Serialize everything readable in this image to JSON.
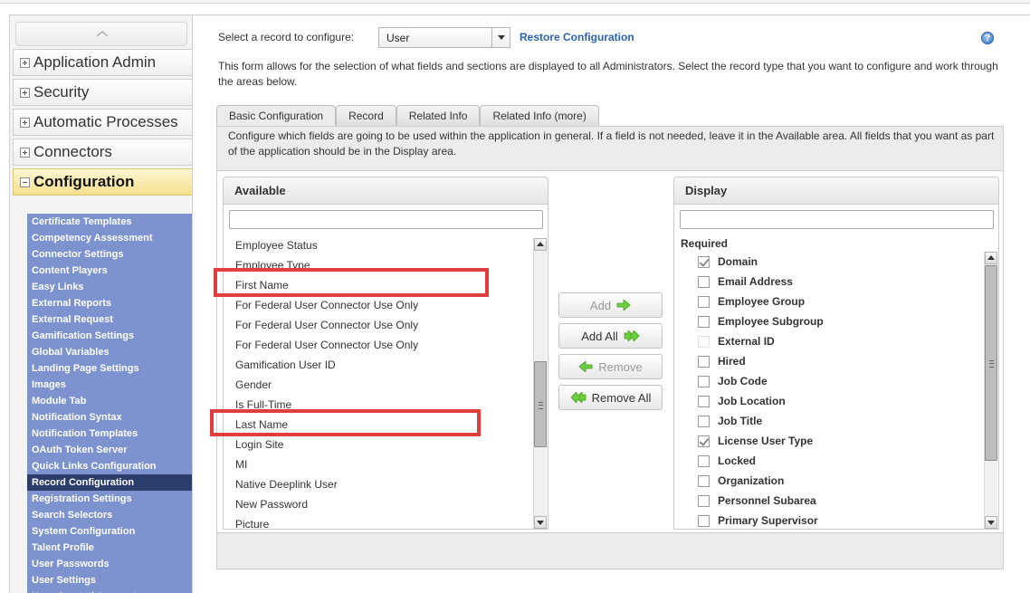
{
  "sidebar": {
    "categories": [
      {
        "label": "Application Admin"
      },
      {
        "label": "Security"
      },
      {
        "label": "Automatic Processes"
      },
      {
        "label": "Connectors"
      },
      {
        "label": "Configuration"
      }
    ],
    "sub_items": [
      "Certificate Templates",
      "Competency Assessment",
      "Connector Settings",
      "Content Players",
      "Easy Links",
      "External Reports",
      "External Request",
      "Gamification Settings",
      "Global Variables",
      "Landing Page Settings",
      "Images",
      "Module Tab",
      "Notification Syntax",
      "Notification Templates",
      "OAuth Token Server",
      "Quick Links Configuration",
      "Record Configuration",
      "Registration Settings",
      "Search Selectors",
      "System Configuration",
      "Talent Profile",
      "User Passwords",
      "User Settings",
      "User-Created Account"
    ],
    "selected_item": "Record Configuration"
  },
  "header": {
    "select_label": "Select a record to configure:",
    "record_value": "User",
    "restore_link": "Restore Configuration",
    "help_icon_glyph": "?"
  },
  "intro": "This form allows for the selection of what fields and sections are displayed to all Administrators.  Select the record type that you want to configure and work through the areas below.",
  "tabs": [
    {
      "label": "Basic Configuration",
      "active": true
    },
    {
      "label": "Record",
      "active": false
    },
    {
      "label": "Related Info",
      "active": false
    },
    {
      "label": "Related Info (more)",
      "active": false
    }
  ],
  "panel": {
    "description": "Configure which fields are going to be used within the application in general. If a field is not needed, leave it in the Available area. All fields that you want as part of the application should be in the Display area."
  },
  "available": {
    "title": "Available",
    "filter_value": "",
    "items": [
      "Employee Status",
      "Employee Type",
      "First Name",
      "For Federal User Connector Use Only",
      "For Federal User Connector Use Only",
      "For Federal User Connector Use Only",
      "Gamification User ID",
      "Gender",
      "Is Full-Time",
      "Last Name",
      "Login Site",
      "MI",
      "Native Deeplink User",
      "New Password",
      "Picture"
    ]
  },
  "buttons": {
    "add": "Add",
    "add_all": "Add All",
    "remove": "Remove",
    "remove_all": "Remove All"
  },
  "display": {
    "title": "Display",
    "filter_value": "",
    "required_label": "Required",
    "items": [
      {
        "label": "Domain",
        "checked": true,
        "box": true
      },
      {
        "label": "Email Address",
        "checked": false,
        "box": true
      },
      {
        "label": "Employee Group",
        "checked": false,
        "box": true
      },
      {
        "label": "Employee Subgroup",
        "checked": false,
        "box": true
      },
      {
        "label": "External ID",
        "checked": false,
        "box": false
      },
      {
        "label": "Hired",
        "checked": false,
        "box": true
      },
      {
        "label": "Job Code",
        "checked": false,
        "box": true
      },
      {
        "label": "Job Location",
        "checked": false,
        "box": true
      },
      {
        "label": "Job Title",
        "checked": false,
        "box": true
      },
      {
        "label": "License User Type",
        "checked": true,
        "box": true
      },
      {
        "label": "Locked",
        "checked": false,
        "box": true
      },
      {
        "label": "Organization",
        "checked": false,
        "box": true
      },
      {
        "label": "Personnel Subarea",
        "checked": false,
        "box": true
      },
      {
        "label": "Primary Supervisor",
        "checked": false,
        "box": true
      }
    ]
  },
  "colors": {
    "nav_sub_bg": "#7d93cf",
    "nav_selected_bg": "#2b3d6b",
    "active_category": "#f5df8c",
    "link": "#2a64ad",
    "highlight_box": "#e03e3e",
    "arrow_green": "#4caf28"
  },
  "highlighted_items": [
    "First Name",
    "Last Name"
  ]
}
